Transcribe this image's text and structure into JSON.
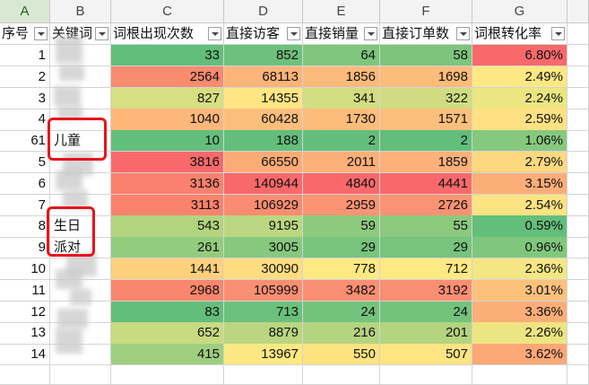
{
  "sheet": {
    "column_letters": [
      "A",
      "B",
      "C",
      "D",
      "E",
      "F",
      "G"
    ],
    "headers": [
      "序号",
      "关键词",
      "词根出现次数",
      "直接访客",
      "直接销量",
      "直接订单数",
      "词根转化率"
    ],
    "rows": [
      {
        "idx": "1",
        "kw": "",
        "c": "33",
        "d": "852",
        "e": "64",
        "f": "58",
        "g": "6.80%"
      },
      {
        "idx": "2",
        "kw": "",
        "c": "2564",
        "d": "68113",
        "e": "1856",
        "f": "1698",
        "g": "2.49%"
      },
      {
        "idx": "3",
        "kw": "",
        "c": "827",
        "d": "14355",
        "e": "341",
        "f": "322",
        "g": "2.24%"
      },
      {
        "idx": "4",
        "kw": "",
        "c": "1040",
        "d": "60428",
        "e": "1730",
        "f": "1571",
        "g": "2.59%"
      },
      {
        "idx": "61",
        "kw": "儿童",
        "c": "10",
        "d": "188",
        "e": "2",
        "f": "2",
        "g": "1.06%"
      },
      {
        "idx": "5",
        "kw": "",
        "c": "3816",
        "d": "66550",
        "e": "2011",
        "f": "1859",
        "g": "2.79%"
      },
      {
        "idx": "6",
        "kw": "",
        "c": "3136",
        "d": "140944",
        "e": "4840",
        "f": "4441",
        "g": "3.15%"
      },
      {
        "idx": "7",
        "kw": "",
        "c": "3113",
        "d": "106929",
        "e": "2959",
        "f": "2726",
        "g": "2.54%"
      },
      {
        "idx": "8",
        "kw": "生日",
        "c": "543",
        "d": "9195",
        "e": "59",
        "f": "55",
        "g": "0.59%"
      },
      {
        "idx": "9",
        "kw": "派对",
        "c": "261",
        "d": "3005",
        "e": "29",
        "f": "29",
        "g": "0.96%"
      },
      {
        "idx": "10",
        "kw": "",
        "c": "1441",
        "d": "30090",
        "e": "778",
        "f": "712",
        "g": "2.36%"
      },
      {
        "idx": "11",
        "kw": "",
        "c": "2968",
        "d": "105999",
        "e": "3482",
        "f": "3192",
        "g": "3.01%"
      },
      {
        "idx": "12",
        "kw": "",
        "c": "83",
        "d": "713",
        "e": "24",
        "f": "24",
        "g": "3.36%"
      },
      {
        "idx": "13",
        "kw": "",
        "c": "652",
        "d": "8879",
        "e": "216",
        "f": "201",
        "g": "2.26%"
      },
      {
        "idx": "14",
        "kw": "",
        "c": "415",
        "d": "13967",
        "e": "550",
        "f": "507",
        "g": "3.62%"
      }
    ],
    "colors": {
      "c": [
        "#63be7b",
        "#f98b6e",
        "#d7df81",
        "#fcb779",
        "#63be7b",
        "#f8696b",
        "#f9816d",
        "#fa836d",
        "#b3d47f",
        "#93cc7d",
        "#fdd07e",
        "#f9866e",
        "#63be7b",
        "#c8db80",
        "#9fcf7e"
      ],
      "d": [
        "#6ec17c",
        "#fcb479",
        "#ffe583",
        "#fcbf7b",
        "#63be7b",
        "#fbab76",
        "#f8696b",
        "#fa8d71",
        "#bcd782",
        "#87c87e",
        "#fedd81",
        "#f98f72",
        "#6bc17c",
        "#bad681",
        "#fce882"
      ],
      "e": [
        "#7fc67d",
        "#fcba7a",
        "#d1dd81",
        "#fcbd7b",
        "#63be7b",
        "#fbb079",
        "#f8696b",
        "#fa9473",
        "#8dca7e",
        "#77c47d",
        "#fee983",
        "#fa8e72",
        "#74c37c",
        "#b5d480",
        "#ffe383"
      ],
      "f": [
        "#7dc57d",
        "#fcbc7a",
        "#cfdc81",
        "#fcbf7b",
        "#63be7b",
        "#fbb179",
        "#f8696b",
        "#fa9373",
        "#8bc97e",
        "#76c47d",
        "#fee983",
        "#fa8e72",
        "#73c37c",
        "#b4d480",
        "#ffe483"
      ],
      "g": [
        "#f8696b",
        "#fee883",
        "#ebe582",
        "#fee182",
        "#86c97e",
        "#fed880",
        "#fbae78",
        "#fee382",
        "#63be7b",
        "#80c77d",
        "#f4e683",
        "#fdc17c",
        "#fcae78",
        "#ede582",
        "#fca877"
      ]
    }
  }
}
